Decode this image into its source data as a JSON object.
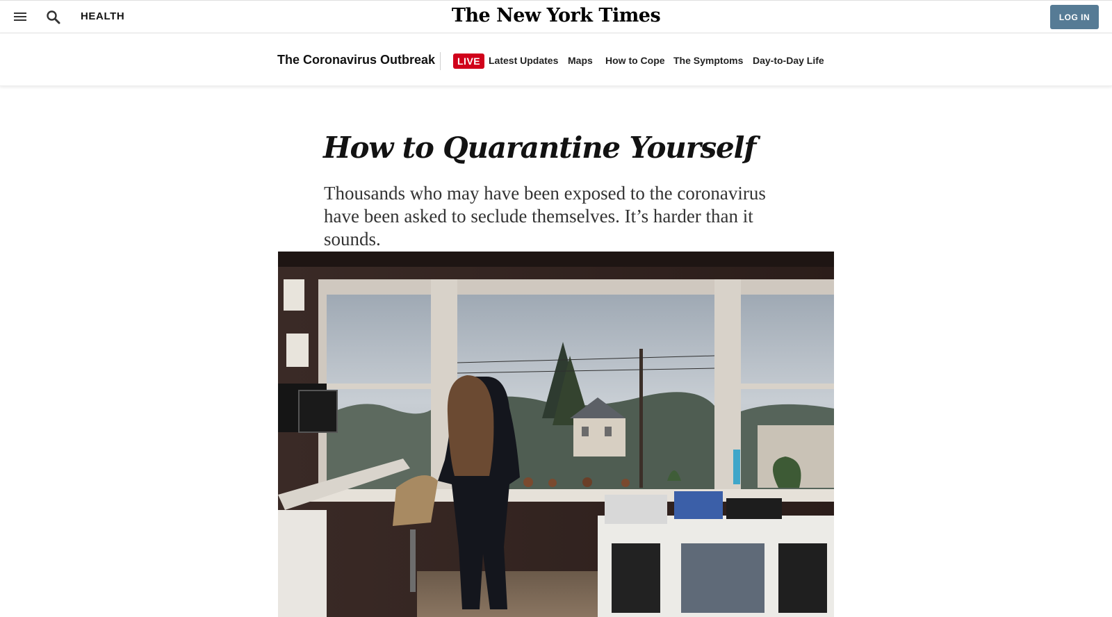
{
  "masthead": {
    "section": "HEALTH",
    "logo": "The New York Times",
    "login_label": "LOG IN",
    "menu_icon": "hamburger-menu-icon",
    "search_icon": "search-icon",
    "login_color": "#567b95"
  },
  "subnav": {
    "title": "The Coronavirus Outbreak",
    "live_badge": "LIVE",
    "live_color": "#d0021b",
    "links": [
      "Latest Updates",
      "Maps",
      "How to Cope",
      "The Symptoms",
      "Day-to-Day Life"
    ]
  },
  "article": {
    "headline": "How to Quarantine Yourself",
    "summary": "Thousands who may have been exposed to the coronavirus have been asked to seclude themselves. It’s harder than it sounds."
  }
}
